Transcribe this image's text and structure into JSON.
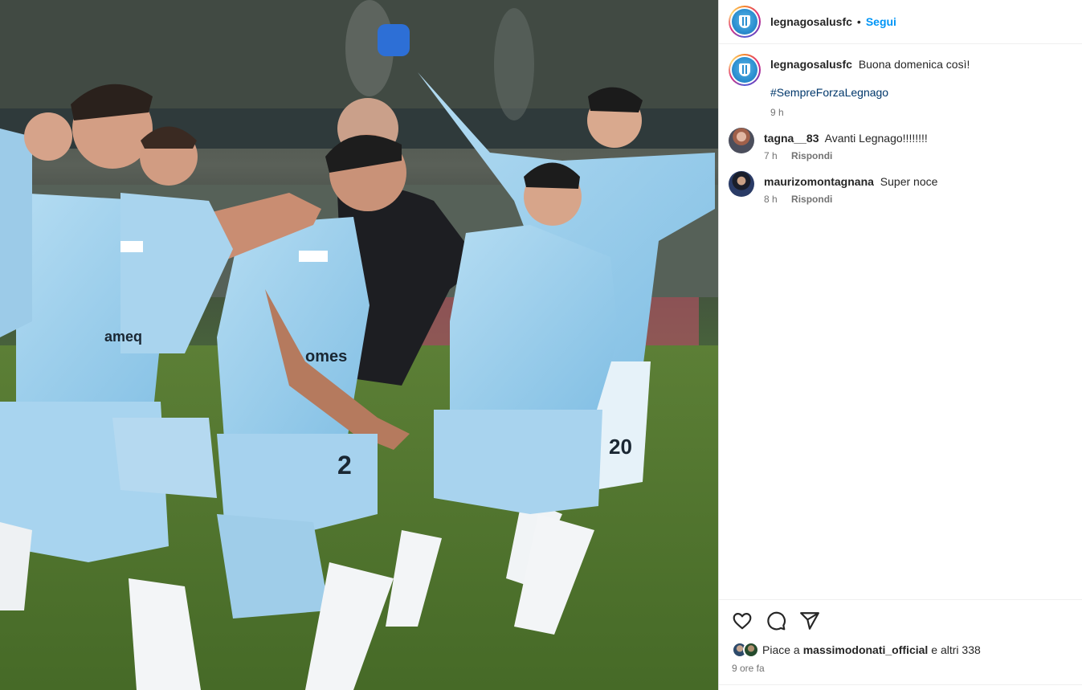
{
  "post": {
    "username": "legnagosalusfc",
    "separator": "•",
    "follow_label": "Segui",
    "photo_alt_subject": "photo"
  },
  "caption": {
    "username": "legnagosalusfc",
    "text": "Buona domenica così!",
    "hashtag": "#SempreForzaLegnago",
    "time": "9 h"
  },
  "comments": [
    {
      "username": "tagna__83",
      "text": "Avanti Legnago!!!!!!!!",
      "time": "7 h",
      "reply_label": "Rispondi"
    },
    {
      "username": "maurizomontagnana",
      "text": "Super noce",
      "time": "8 h",
      "reply_label": "Rispondi"
    }
  ],
  "actions": {
    "like_icon": "heart-icon",
    "comment_icon": "comment-icon",
    "share_icon": "send-icon"
  },
  "likes": {
    "prefix": "Piace a",
    "user": "massimodonati_official",
    "suffix": "e altri 338"
  },
  "posted_ago": "9 ore fa",
  "colors": {
    "link_blue": "#0095f6",
    "hashtag_blue": "#00376b",
    "jersey": "#9fcde9",
    "meta_gray": "#737373"
  }
}
